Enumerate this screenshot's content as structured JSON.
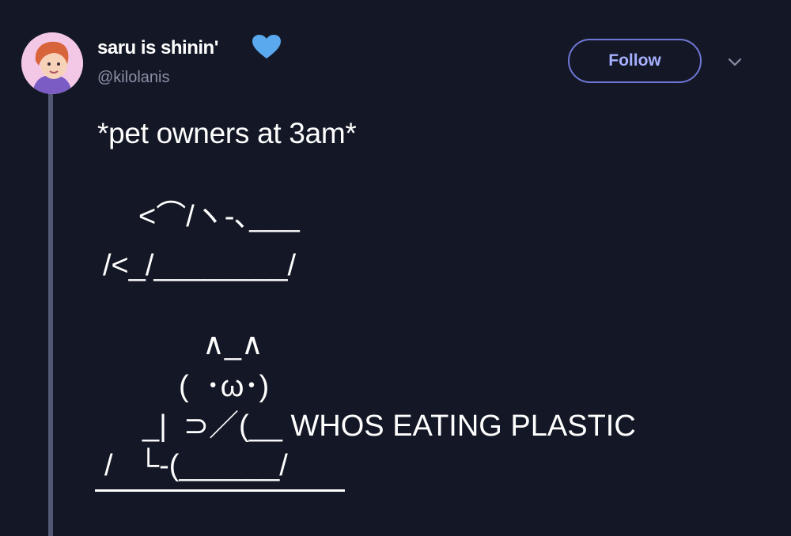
{
  "tweet": {
    "author": {
      "display_name": "saru is shinin'",
      "handle": "@kilolanis",
      "verified_icon": "blue-heart-icon",
      "avatar": "avatar-icon"
    },
    "follow_label": "Follow",
    "more_icon": "chevron-down-icon",
    "text": "*pet owners at 3am*",
    "ascii_art": [
      "<⌒/ヽ-､___",
      "/<_/________/",
      "∧_∧",
      "(  ･ω･)",
      "_|  ⊃／(__ WHOS EATING PLASTIC",
      "/   └-(______/"
    ]
  },
  "colors": {
    "background": "#141826",
    "accent": "#6f77d6",
    "heart": "#5aa8ee",
    "thread_line": "#525773"
  }
}
